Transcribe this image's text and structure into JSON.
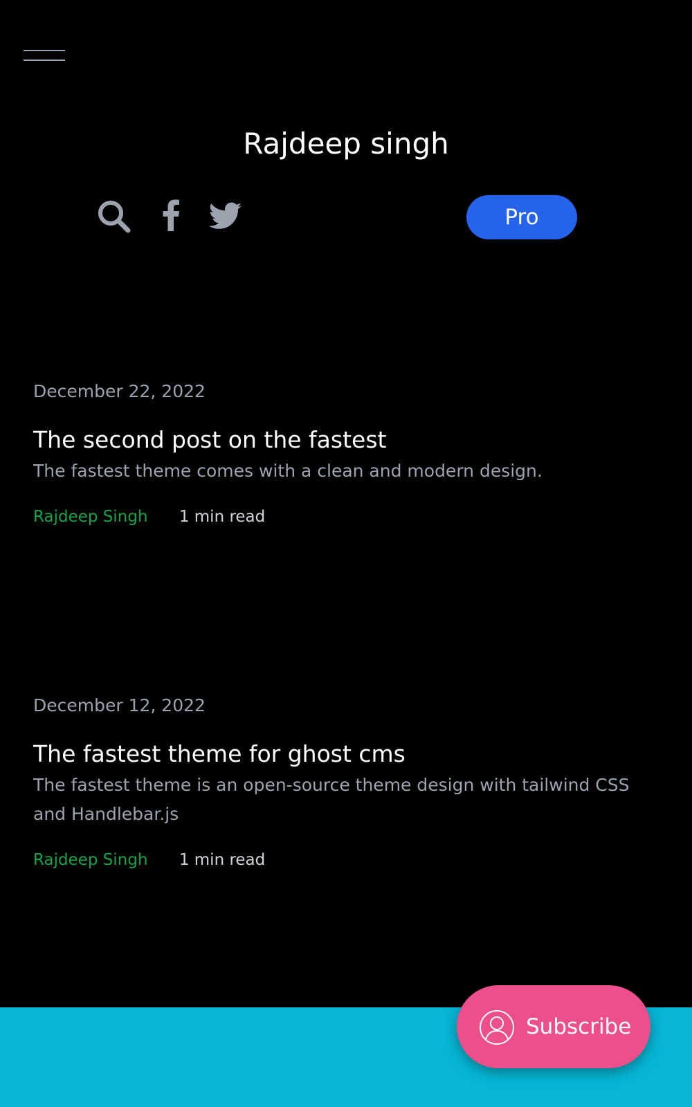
{
  "header": {
    "site_title": "Rajdeep singh",
    "pro_label": "Pro",
    "icons": [
      "menu-icon",
      "search-icon",
      "facebook-icon",
      "twitter-icon"
    ]
  },
  "posts": [
    {
      "date": "December 22, 2022",
      "title": "The second post on the fastest",
      "excerpt": "The fastest theme comes with a clean and modern design.",
      "author": "Rajdeep Singh",
      "read_time": "1 min read"
    },
    {
      "date": "December 12, 2022",
      "title": "The fastest theme for ghost cms",
      "excerpt": "The fastest theme is an open-source theme design with tailwind CSS and Handlebar.js",
      "author": "Rajdeep Singh",
      "read_time": "1 min read"
    }
  ],
  "subscribe": {
    "label": "Subscribe",
    "icon": "user-icon"
  },
  "colors": {
    "background": "#000000",
    "pro_button": "#2563eb",
    "author_link": "#16a34a",
    "footer_band": "#06b6d4",
    "subscribe_button": "#ec4f8c",
    "muted_text": "#9ca3af"
  }
}
